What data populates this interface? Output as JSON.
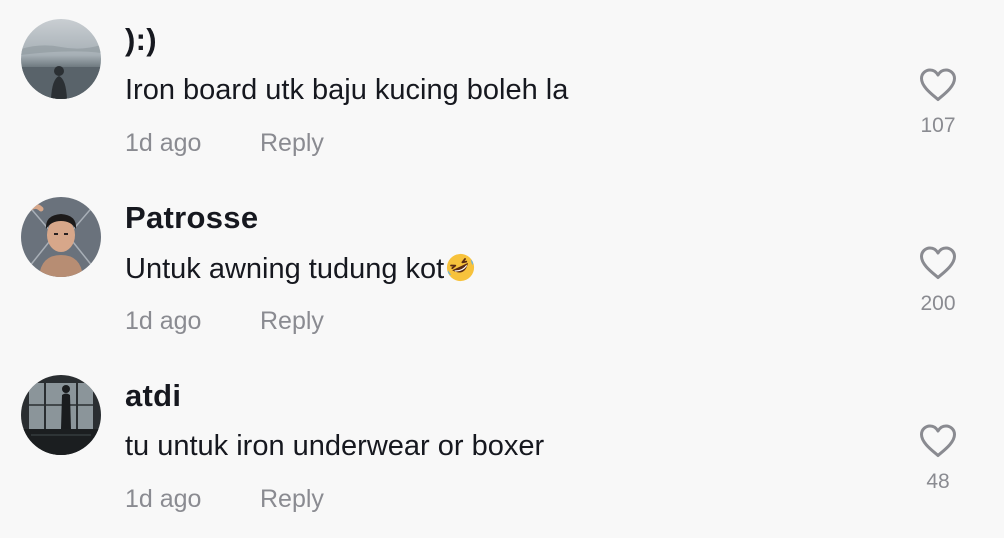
{
  "comments": [
    {
      "username": "):)",
      "text": "Iron board utk baju kucing boleh la",
      "time": "1d ago",
      "reply_label": "Reply",
      "likes": "107",
      "avatar": "profile-photo-silhouette-sky"
    },
    {
      "username": "Patrosse",
      "text": "Untuk awning tudung kot",
      "emoji": "rolling-on-floor-laughing-emoji",
      "time": "1d ago",
      "reply_label": "Reply",
      "likes": "200",
      "avatar": "profile-photo-young-man"
    },
    {
      "username": "atdi",
      "text": "tu untuk iron underwear or boxer",
      "time": "1d ago",
      "reply_label": "Reply",
      "likes": "48",
      "avatar": "profile-photo-dark-window-silhouette"
    }
  ],
  "colors": {
    "background": "#f8f8f8",
    "text_primary": "#16181f",
    "text_secondary": "#8a8b91",
    "heart_stroke": "#8a8b91"
  },
  "icons": {
    "like": "heart-outline-icon"
  }
}
